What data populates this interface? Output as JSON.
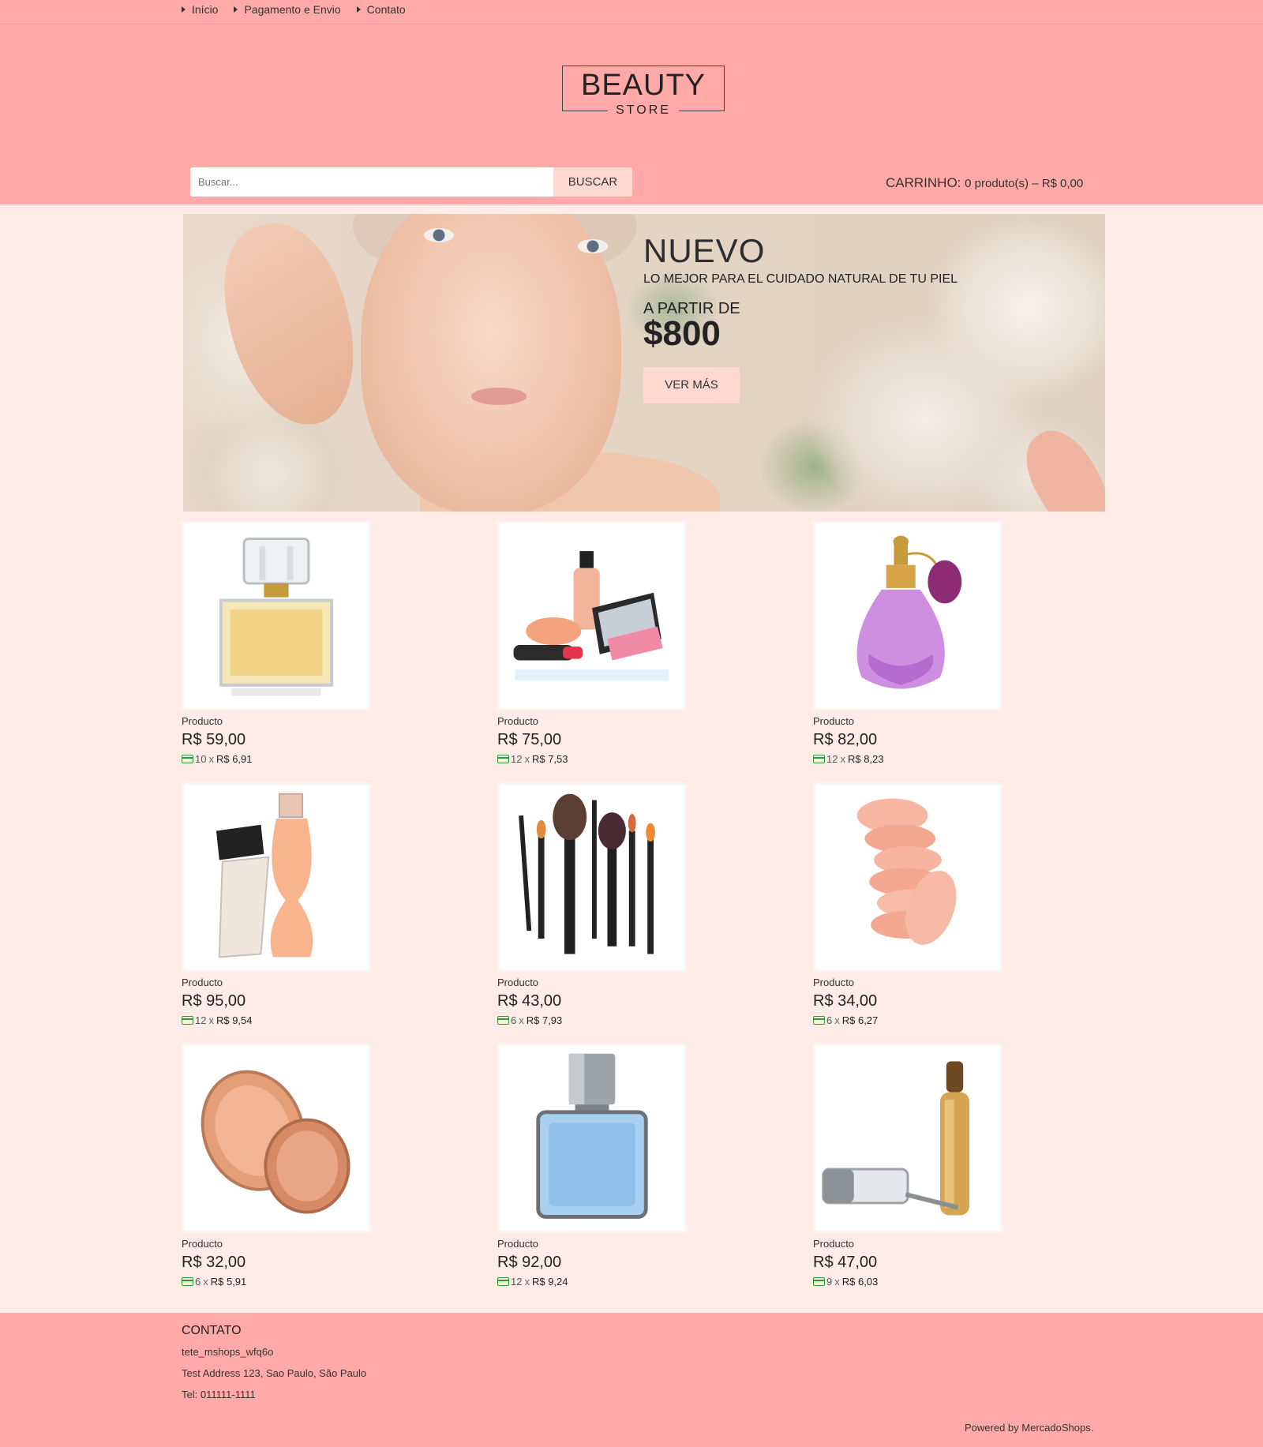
{
  "nav": {
    "items": [
      "Início",
      "Pagamento e Envio",
      "Contato"
    ]
  },
  "logo": {
    "line1": "BEAUTY",
    "line2": "STORE"
  },
  "search": {
    "placeholder": "Buscar...",
    "button": "BUSCAR"
  },
  "cart": {
    "label": "CARRINHO:",
    "value": "0 produto(s) – R$ 0,00"
  },
  "banner": {
    "title": "NUEVO",
    "subtitle": "LO MEJOR PARA EL CUIDADO NATURAL DE TU PIEL",
    "from": "A PARTIR DE",
    "price": "$800",
    "button": "VER MÁS"
  },
  "products": [
    {
      "name": "Producto",
      "price": "R$ 59,00",
      "inst_n": "10",
      "inst_x": "x",
      "inst_val": "R$ 6,91",
      "icon": "perfume-bottle-icon"
    },
    {
      "name": "Producto",
      "price": "R$ 75,00",
      "inst_n": "12",
      "inst_x": "x",
      "inst_val": "R$ 7,53",
      "icon": "makeup-kit-icon"
    },
    {
      "name": "Producto",
      "price": "R$ 82,00",
      "inst_n": "12",
      "inst_x": "x",
      "inst_val": "R$ 8,23",
      "icon": "atomizer-icon"
    },
    {
      "name": "Producto",
      "price": "R$ 95,00",
      "inst_n": "12",
      "inst_x": "x",
      "inst_val": "R$ 9,54",
      "icon": "perfume-pair-icon"
    },
    {
      "name": "Producto",
      "price": "R$ 43,00",
      "inst_n": "6",
      "inst_x": "x",
      "inst_val": "R$ 7,93",
      "icon": "brushes-icon"
    },
    {
      "name": "Producto",
      "price": "R$ 34,00",
      "inst_n": "6",
      "inst_x": "x",
      "inst_val": "R$ 6,27",
      "icon": "sponges-icon"
    },
    {
      "name": "Producto",
      "price": "R$ 32,00",
      "inst_n": "6",
      "inst_x": "x",
      "inst_val": "R$ 5,91",
      "icon": "compact-powder-icon"
    },
    {
      "name": "Producto",
      "price": "R$ 92,00",
      "inst_n": "12",
      "inst_x": "x",
      "inst_val": "R$ 9,24",
      "icon": "blue-perfume-icon"
    },
    {
      "name": "Producto",
      "price": "R$ 47,00",
      "inst_n": "9",
      "inst_x": "x",
      "inst_val": "R$ 6,03",
      "icon": "foundation-mascara-icon"
    }
  ],
  "footer": {
    "title": "CONTATO",
    "lines": [
      "tete_mshops_wfq6o",
      "Test Address 123, Sao Paulo, São Paulo",
      "Tel: 011111-1111"
    ],
    "powered": "Powered by MercadoShops."
  },
  "colors": {
    "header_bg": "#ffaaa8",
    "page_bg": "#ffece6",
    "button_bg": "#ffd8d0",
    "installment_icon": "#2e9b2e"
  }
}
